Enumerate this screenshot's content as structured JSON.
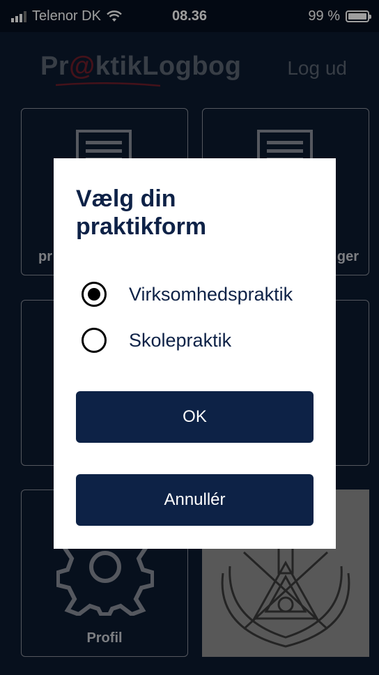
{
  "status_bar": {
    "carrier": "Telenor DK",
    "time": "08.36",
    "battery_percent": "99 %",
    "battery_level": 0.99
  },
  "header": {
    "logo_part1": "Pr",
    "logo_at": "@",
    "logo_part2": "ktikLogbog",
    "logout": "Log ud"
  },
  "tiles": {
    "top_left_label_fragment": "pr",
    "top_right_label_fragment": "ger",
    "profile_label": "Profil"
  },
  "dialog": {
    "title": "Vælg din praktikform",
    "options": [
      {
        "label": "Virksomhedspraktik",
        "selected": true
      },
      {
        "label": "Skolepraktik",
        "selected": false
      }
    ],
    "ok_label": "OK",
    "cancel_label": "Annullér"
  },
  "colors": {
    "background": "#0c1a2f",
    "primary_button": "#0d2246",
    "logo_accent": "#6e1d2a"
  }
}
